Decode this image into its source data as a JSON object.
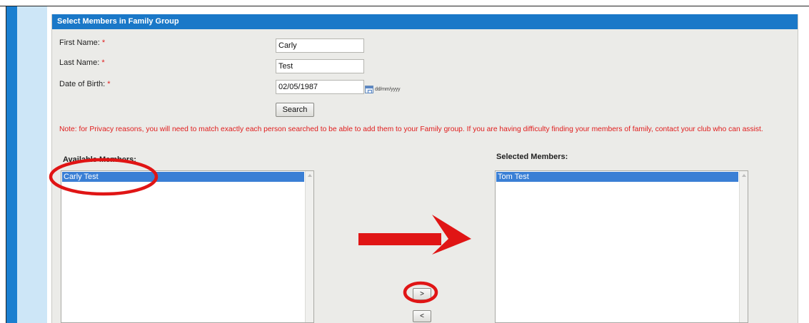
{
  "panel": {
    "title": "Select Members in Family Group"
  },
  "form": {
    "first_name": {
      "label": "First Name:",
      "required_mark": "*",
      "value": "Carly"
    },
    "last_name": {
      "label": "Last Name:",
      "required_mark": "*",
      "value": "Test"
    },
    "date_of_birth": {
      "label": "Date of Birth:",
      "required_mark": "*",
      "value": "02/05/1987",
      "format_hint": "dd/mm/yyyy"
    },
    "search_label": "Search"
  },
  "note": "Note: for Privacy reasons, you will need to match exactly each person searched to be able to add them to your Family group. If you are having difficulty finding your members of family, contact your club who can assist.",
  "available": {
    "title": "Available Members:",
    "items": [
      "Carly Test"
    ]
  },
  "selected": {
    "title": "Selected Members:",
    "items": [
      "Tom Test"
    ]
  },
  "buttons": {
    "add_label": ">",
    "remove_label": "<"
  },
  "colors": {
    "header": "#1a78c8",
    "side_stripe": "#1a7fd0",
    "selection": "#3a7fd5",
    "note_text": "#e01c1c",
    "annotation_red": "#e01515"
  }
}
